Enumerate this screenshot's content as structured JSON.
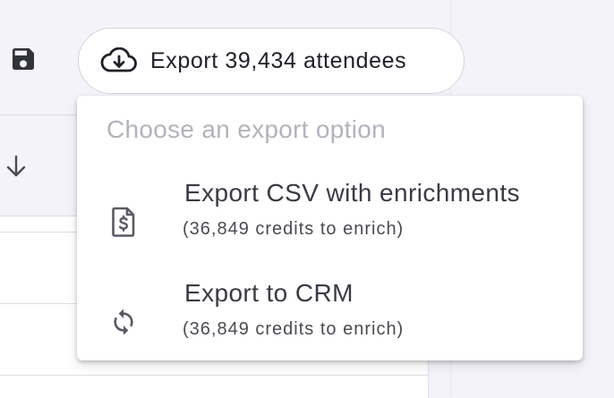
{
  "toolbar": {
    "save_icon": "floppy-disk-icon",
    "export_button": {
      "icon": "cloud-download-icon",
      "label": "Export 39,434 attendees"
    }
  },
  "table": {
    "sort_icon": "arrow-down-icon"
  },
  "export_menu": {
    "hint": "Choose an export option",
    "options": [
      {
        "icon": "file-dollar-icon",
        "title": "Export CSV with enrichments",
        "subtitle": "(36,849 credits to enrich)"
      },
      {
        "icon": "sync-icon",
        "title": "Export to CRM",
        "subtitle": "(36,849 credits to enrich)"
      }
    ]
  },
  "colors": {
    "background": "#f3f3f9",
    "button_border": "#d4d4dc",
    "text_primary": "#1f1f28",
    "text_hint": "#b3b3bb",
    "icon": "#5a5a64"
  }
}
